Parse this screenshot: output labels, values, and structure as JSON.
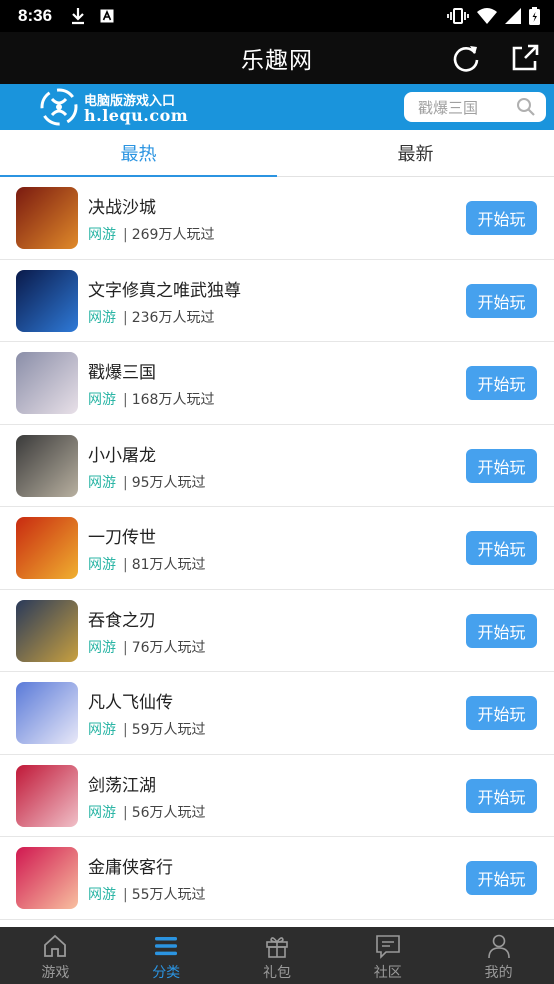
{
  "status": {
    "time": "8:36",
    "icons_left": [
      "download-icon",
      "a-icon"
    ],
    "icons_right": [
      "vibrate-icon",
      "wifi-icon",
      "signal-icon",
      "battery-icon"
    ]
  },
  "appbar": {
    "title": "乐趣网",
    "icons": [
      "refresh-icon",
      "share-icon"
    ]
  },
  "banner": {
    "logo_line1": "电脑版游戏入口",
    "logo_line2": "h.lequ.com",
    "search_placeholder": "戳爆三国"
  },
  "tabs": [
    {
      "label": "最热",
      "active": true
    },
    {
      "label": "最新",
      "active": false
    }
  ],
  "games": [
    {
      "name": "决战沙城",
      "tag": "网游",
      "plays": "269万人玩过",
      "button": "开始玩",
      "colors": [
        "#7a1a10",
        "#e08a2a"
      ]
    },
    {
      "name": "文字修真之唯武独尊",
      "tag": "网游",
      "plays": "236万人玩过",
      "button": "开始玩",
      "colors": [
        "#0a1a4a",
        "#2f7ad8"
      ]
    },
    {
      "name": "戳爆三国",
      "tag": "网游",
      "plays": "168万人玩过",
      "button": "开始玩",
      "colors": [
        "#8a8ea8",
        "#e8e0e8"
      ]
    },
    {
      "name": "小小屠龙",
      "tag": "网游",
      "plays": "95万人玩过",
      "button": "开始玩",
      "colors": [
        "#3a3a3a",
        "#b8b0a0"
      ]
    },
    {
      "name": "一刀传世",
      "tag": "网游",
      "plays": "81万人玩过",
      "button": "开始玩",
      "colors": [
        "#c82a10",
        "#f0b030"
      ]
    },
    {
      "name": "吞食之刃",
      "tag": "网游",
      "plays": "76万人玩过",
      "button": "开始玩",
      "colors": [
        "#2a3a5a",
        "#c8a040"
      ]
    },
    {
      "name": "凡人飞仙传",
      "tag": "网游",
      "plays": "59万人玩过",
      "button": "开始玩",
      "colors": [
        "#5a7ad8",
        "#e8e8f8"
      ]
    },
    {
      "name": "剑荡江湖",
      "tag": "网游",
      "plays": "56万人玩过",
      "button": "开始玩",
      "colors": [
        "#c01838",
        "#f0c0c8"
      ]
    },
    {
      "name": "金庸侠客行",
      "tag": "网游",
      "plays": "55万人玩过",
      "button": "开始玩",
      "colors": [
        "#d01850",
        "#f8c0a0"
      ]
    }
  ],
  "bottom_nav": [
    {
      "label": "游戏",
      "icon": "home-icon",
      "active": false
    },
    {
      "label": "分类",
      "icon": "menu-icon",
      "active": true
    },
    {
      "label": "礼包",
      "icon": "gift-icon",
      "active": false
    },
    {
      "label": "社区",
      "icon": "chat-icon",
      "active": false
    },
    {
      "label": "我的",
      "icon": "user-icon",
      "active": false
    }
  ],
  "colors": {
    "accent": "#2b94e1",
    "banner": "#1a94dc",
    "tag": "#2bb5a5",
    "button": "#46a1ee"
  }
}
